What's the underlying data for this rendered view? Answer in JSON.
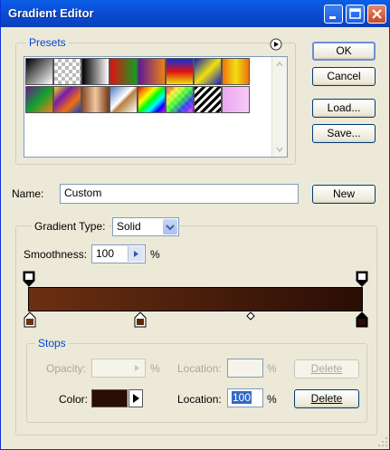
{
  "window": {
    "title": "Gradient Editor"
  },
  "presets": {
    "label": "Presets",
    "swatch_names": [
      "Foreground to Background",
      "Foreground to Transparent",
      "Black, White",
      "Red, Green",
      "Violet, Orange",
      "Blue, Red, Yellow",
      "Blue, Yellow, Blue",
      "Orange, Yellow, Orange",
      "Violet, Green, Orange",
      "Yellow, Violet, Orange, Blue",
      "Copper",
      "Chrome",
      "Spectrum",
      "Transparent Rainbow",
      "Transparent Stripes",
      "Pastel Pink"
    ]
  },
  "buttons": {
    "ok": "OK",
    "cancel": "Cancel",
    "load": "Load...",
    "save": "Save...",
    "new": "New"
  },
  "name": {
    "label": "Name:",
    "value": "Custom"
  },
  "gradient_type": {
    "label": "Gradient Type:",
    "value": "Solid"
  },
  "smoothness": {
    "label": "Smoothness:",
    "value": "100",
    "unit": "%"
  },
  "gradient": {
    "start_color": "#6b3012",
    "end_color": "#2a0d05"
  },
  "stops": {
    "label": "Stops",
    "opacity_label": "Opacity:",
    "opacity_unit": "%",
    "opacity_location_label": "Location:",
    "opacity_location_unit": "%",
    "opacity_delete": "Delete",
    "color_label": "Color:",
    "color_value": "#2a0d05",
    "color_location_label": "Location:",
    "color_location_value": "100",
    "color_location_unit": "%",
    "color_delete": "Delete"
  }
}
